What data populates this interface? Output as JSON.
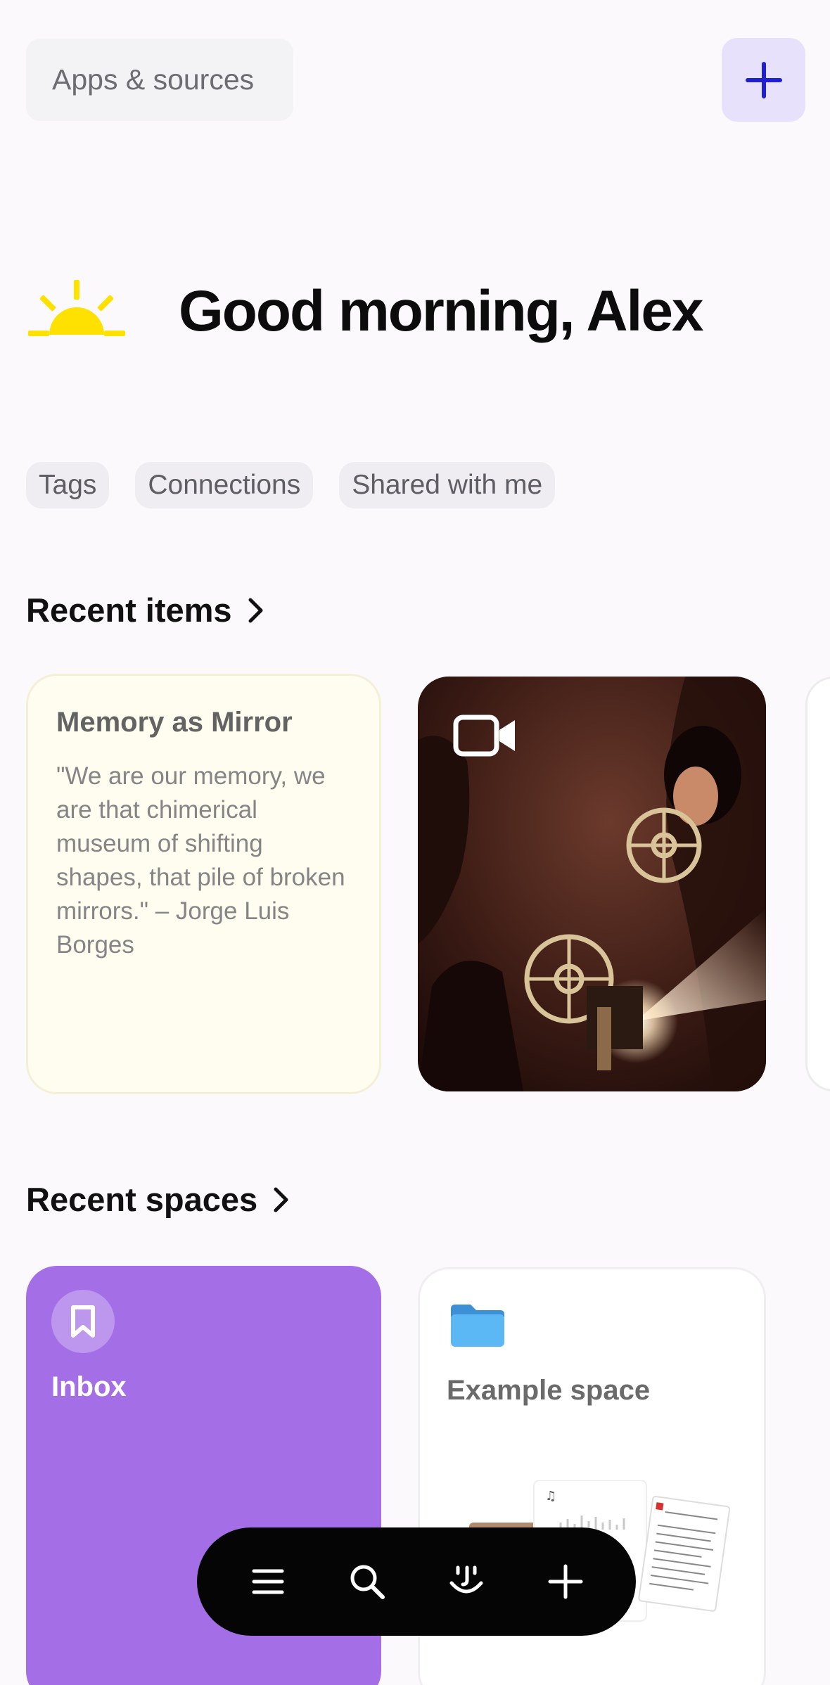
{
  "header": {
    "apps_label": "Apps & sources",
    "add_icon": "plus-icon"
  },
  "greeting": {
    "icon": "sunrise-icon",
    "text": "Good morning, Alex"
  },
  "chips": [
    {
      "label": "Tags"
    },
    {
      "label": "Connections"
    },
    {
      "label": "Shared with me"
    }
  ],
  "recent_items": {
    "title": "Recent items",
    "note": {
      "title": "Memory as Mirror",
      "body": "\"We are our memory, we are that chimerical museum of shifting shapes, that pile of broken mirrors.\" – Jorge Luis Borges"
    },
    "video": {
      "icon": "video-camera-icon"
    }
  },
  "recent_spaces": {
    "title": "Recent spaces",
    "inbox": {
      "label": "Inbox",
      "icon": "bookmark-icon"
    },
    "example": {
      "label": "Example space",
      "icon": "folder-icon"
    }
  },
  "bottom_nav": [
    {
      "icon": "menu-icon"
    },
    {
      "icon": "search-icon"
    },
    {
      "icon": "assistant-face-icon"
    },
    {
      "icon": "plus-icon"
    }
  ],
  "colors": {
    "accent": "#a46fe6",
    "add_button_bg": "#e8e1fb",
    "add_button_icon": "#1f1fd6",
    "sun": "#ffe100",
    "note_bg": "#fefdf0",
    "folder": "#5bb8f5"
  }
}
